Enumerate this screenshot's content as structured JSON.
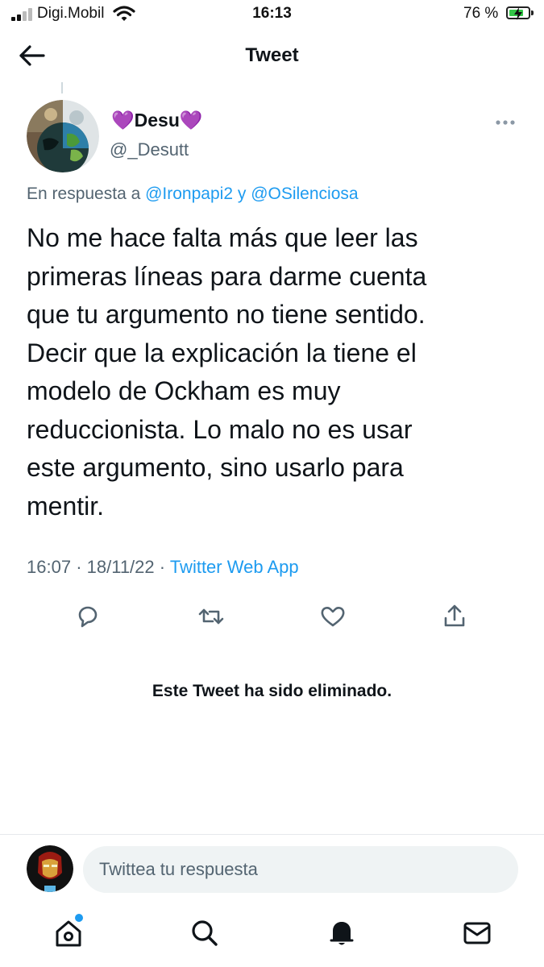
{
  "status_bar": {
    "carrier": "Digi.Mobil",
    "time": "16:13",
    "battery_percent": "76 %",
    "battery_level": 0.76,
    "icons": [
      "signal-icon",
      "wifi-icon",
      "battery-charging-icon"
    ]
  },
  "header": {
    "title": "Tweet",
    "icons": [
      "back-arrow-icon"
    ]
  },
  "tweet": {
    "author_name": "💜Desu💜",
    "author_handle": "@_Desutt",
    "reply_prefix": "En respuesta a",
    "reply_user_1": "@Ironpapi2",
    "reply_connector": "y",
    "reply_user_2": "@OSilenciosa",
    "text": "No me hace falta más que leer las\nprimeras líneas para darme cuenta\nque tu argumento no tiene sentido.\nDecir que la explicación la tiene el\nmodelo de Ockham es muy\nreduccionista. Lo malo no es usar\neste argumento, sino usarlo para\nmentir.",
    "time": "16:07",
    "separator": "·",
    "date": "18/11/22",
    "source": "Twitter Web App",
    "actions": [
      "reply-icon",
      "retweet-icon",
      "like-icon",
      "share-icon"
    ],
    "more_icon": "more-horizontal-icon"
  },
  "deleted_notice": "Este Tweet ha sido eliminado.",
  "composer": {
    "placeholder": "Twittea tu respuesta"
  },
  "tab_bar": {
    "tabs": [
      "home-icon",
      "search-icon",
      "notifications-icon",
      "messages-icon"
    ],
    "home_has_notification": true
  },
  "colors": {
    "accent": "#1d9bf0",
    "text": "#0f1419",
    "secondary_text": "#536471",
    "battery_green": "#33c748",
    "composer_bg": "#eff3f4"
  }
}
